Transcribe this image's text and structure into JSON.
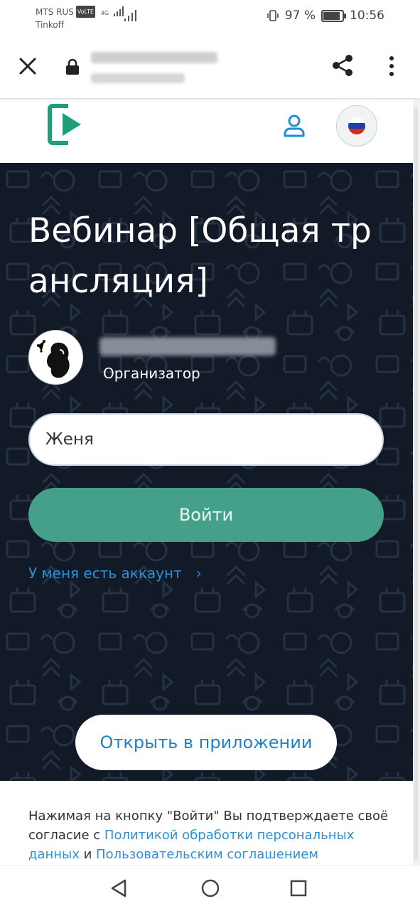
{
  "status_bar": {
    "carrier": "MTS RUS",
    "volte": "VoLTE",
    "network": "4G",
    "second_carrier": "Tinkoff",
    "battery": "97 %",
    "battery_level": 0.97,
    "time": "10:56"
  },
  "browser": {
    "icons": [
      "close-icon",
      "lock-icon",
      "share-icon",
      "more-vert-icon"
    ]
  },
  "site_header": {
    "icons": [
      "enter-logo-icon",
      "user-icon",
      "flag-ru-icon"
    ]
  },
  "event": {
    "title": "Вебинар [Общая трансляция]",
    "organizer_role": "Организатор"
  },
  "form": {
    "name_value": "Женя",
    "login_button": "Войти",
    "account_link": "У меня есть аккаунт",
    "chevron": "›",
    "open_app_button": "Открыть в приложении"
  },
  "footer": {
    "text_1": "Нажимая на кнопку \"Войти\" Вы подтверждаете своё согласие с ",
    "link_policy": "Политикой обработки персональных данных",
    "text_and": " и ",
    "link_terms": "Пользовательским соглашением"
  },
  "colors": {
    "brand_green": "#45a08a",
    "logo_green": "#1f9e7c",
    "link_blue": "#2f8fd6",
    "hero_bg": "#111a26"
  },
  "nav_bar": {
    "icons": [
      "back-triangle-icon",
      "home-circle-icon",
      "recent-square-icon"
    ]
  }
}
